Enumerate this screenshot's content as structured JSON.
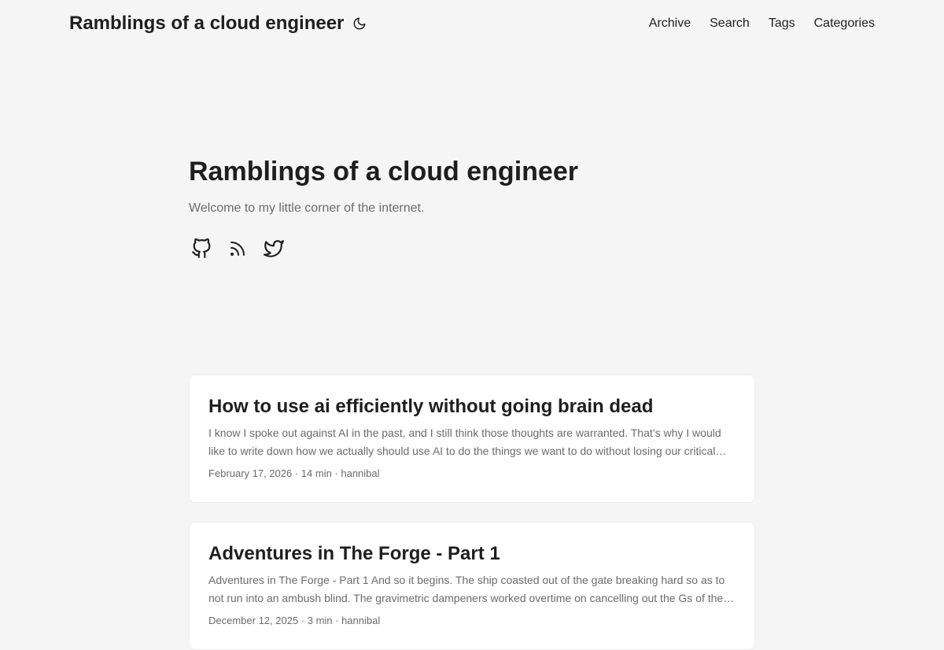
{
  "header": {
    "logo": "Ramblings of a cloud engineer",
    "theme_toggle_icon": "moon-icon",
    "nav": [
      {
        "label": "Archive"
      },
      {
        "label": "Search"
      },
      {
        "label": "Tags"
      },
      {
        "label": "Categories"
      }
    ]
  },
  "hero": {
    "title": "Ramblings of a cloud engineer",
    "subtitle": "Welcome to my little corner of the internet.",
    "social": [
      {
        "icon": "github-icon"
      },
      {
        "icon": "rss-icon"
      },
      {
        "icon": "twitter-icon"
      }
    ]
  },
  "posts": [
    {
      "title": "How to use ai efficiently without going brain dead",
      "excerpt": "I know I spoke out against AI in the past, and I still think those thoughts are warranted. That’s why I would like to write down how we actually should use AI to do the things we want to do without losing our critical…",
      "meta": "February 17, 2026 · 14 min · hannibal"
    },
    {
      "title": "Adventures in The Forge - Part 1",
      "excerpt": "Adventures in The Forge - Part 1 And so it begins. The ship coasted out of the gate breaking hard so as to not run into an ambush blind. The gravimetric dampeners worked overtime on cancelling out the Gs of the…",
      "meta": "December 12, 2025 · 3 min · hannibal"
    }
  ],
  "colors": {
    "background": "#f5f5f5",
    "card": "#ffffff",
    "text": "#1e1e1e",
    "muted": "#6b6b6b"
  }
}
